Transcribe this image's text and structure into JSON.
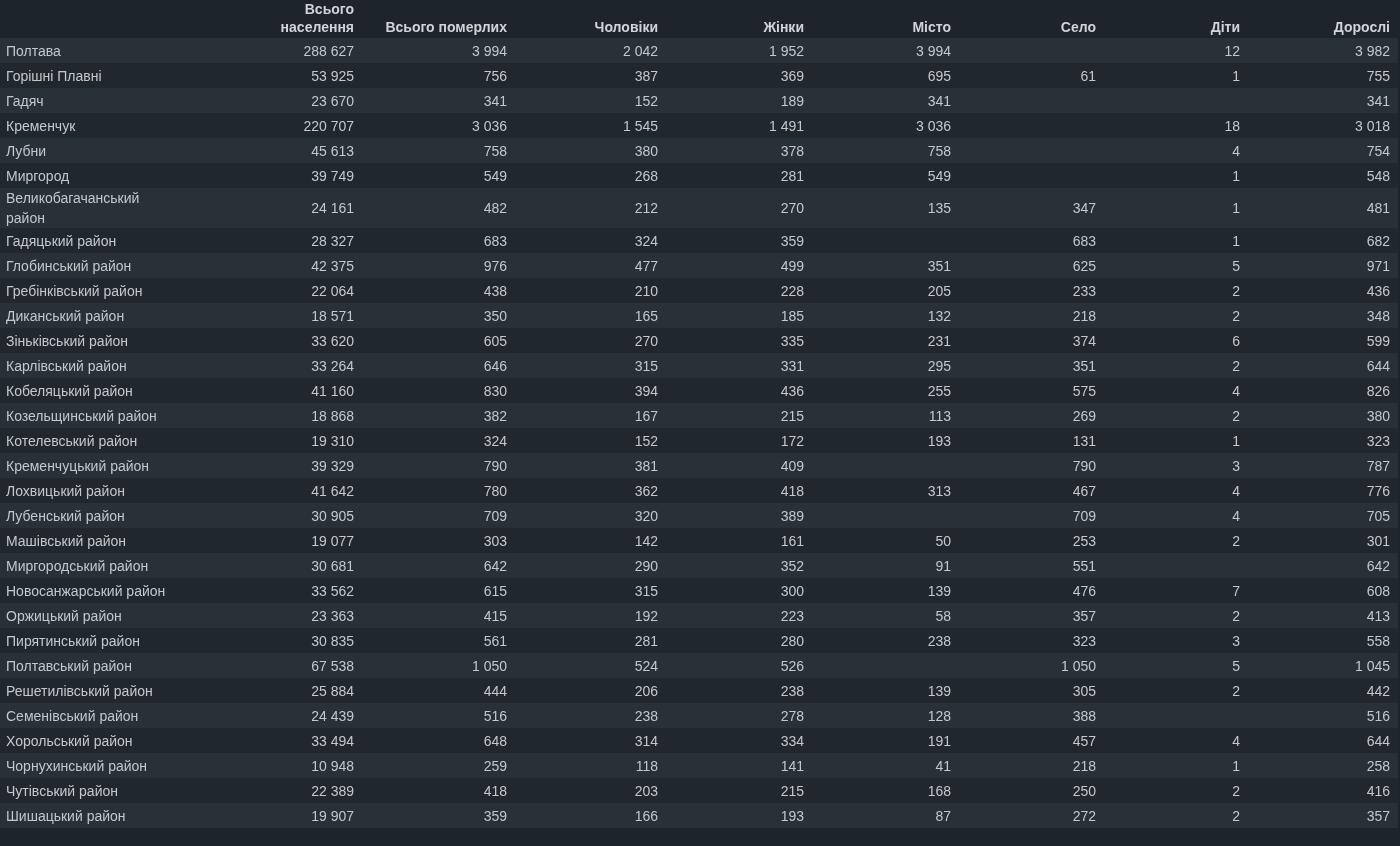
{
  "table": {
    "columns": [
      "Всього населення",
      "Всього померлих",
      "Чоловіки",
      "Жінки",
      "Місто",
      "Село",
      "Діти",
      "Дорослі"
    ],
    "rows": [
      {
        "name": "Полтава",
        "population": "288 627",
        "deaths": "3 994",
        "men": "2 042",
        "women": "1 952",
        "city": "3 994",
        "children": "12",
        "adults": "3 982"
      },
      {
        "name": "Горішні Плавні",
        "population": "53 925",
        "deaths": "756",
        "men": "387",
        "women": "369",
        "city": "695",
        "village": "61",
        "children": "1",
        "adults": "755"
      },
      {
        "name": "Гадяч",
        "population": "23 670",
        "deaths": "341",
        "men": "152",
        "women": "189",
        "city": "341",
        "adults": "341"
      },
      {
        "name": "Кременчук",
        "population": "220 707",
        "deaths": "3 036",
        "men": "1 545",
        "women": "1 491",
        "city": "3 036",
        "children": "18",
        "adults": "3 018"
      },
      {
        "name": "Лубни",
        "population": "45 613",
        "deaths": "758",
        "men": "380",
        "women": "378",
        "city": "758",
        "children": "4",
        "adults": "754"
      },
      {
        "name": "Миргород",
        "population": "39 749",
        "deaths": "549",
        "men": "268",
        "women": "281",
        "city": "549",
        "children": "1",
        "adults": "548"
      },
      {
        "name": "Великобагачанський район",
        "population": "24 161",
        "deaths": "482",
        "men": "212",
        "women": "270",
        "city": "135",
        "village": "347",
        "children": "1",
        "adults": "481"
      },
      {
        "name": "Гадяцький район",
        "population": "28 327",
        "deaths": "683",
        "men": "324",
        "women": "359",
        "village": "683",
        "children": "1",
        "adults": "682"
      },
      {
        "name": "Глобинський район",
        "population": "42 375",
        "deaths": "976",
        "men": "477",
        "women": "499",
        "city": "351",
        "village": "625",
        "children": "5",
        "adults": "971"
      },
      {
        "name": "Гребінківський район",
        "population": "22 064",
        "deaths": "438",
        "men": "210",
        "women": "228",
        "city": "205",
        "village": "233",
        "children": "2",
        "adults": "436"
      },
      {
        "name": "Диканський район",
        "population": "18 571",
        "deaths": "350",
        "men": "165",
        "women": "185",
        "city": "132",
        "village": "218",
        "children": "2",
        "adults": "348"
      },
      {
        "name": "Зіньківський район",
        "population": "33 620",
        "deaths": "605",
        "men": "270",
        "women": "335",
        "city": "231",
        "village": "374",
        "children": "6",
        "adults": "599"
      },
      {
        "name": "Карлівський район",
        "population": "33 264",
        "deaths": "646",
        "men": "315",
        "women": "331",
        "city": "295",
        "village": "351",
        "children": "2",
        "adults": "644"
      },
      {
        "name": "Кобеляцький район",
        "population": "41 160",
        "deaths": "830",
        "men": "394",
        "women": "436",
        "city": "255",
        "village": "575",
        "children": "4",
        "adults": "826"
      },
      {
        "name": "Козельщинський район",
        "population": "18 868",
        "deaths": "382",
        "men": "167",
        "women": "215",
        "city": "113",
        "village": "269",
        "children": "2",
        "adults": "380"
      },
      {
        "name": "Котелевський район",
        "population": "19 310",
        "deaths": "324",
        "men": "152",
        "women": "172",
        "city": "193",
        "village": "131",
        "children": "1",
        "adults": "323"
      },
      {
        "name": "Кременчуцький район",
        "population": "39 329",
        "deaths": "790",
        "men": "381",
        "women": "409",
        "village": "790",
        "children": "3",
        "adults": "787"
      },
      {
        "name": "Лохвицький район",
        "population": "41 642",
        "deaths": "780",
        "men": "362",
        "women": "418",
        "city": "313",
        "village": "467",
        "children": "4",
        "adults": "776"
      },
      {
        "name": "Лубенський район",
        "population": "30 905",
        "deaths": "709",
        "men": "320",
        "women": "389",
        "village": "709",
        "children": "4",
        "adults": "705"
      },
      {
        "name": "Машівський район",
        "population": "19 077",
        "deaths": "303",
        "men": "142",
        "women": "161",
        "city": "50",
        "village": "253",
        "children": "2",
        "adults": "301"
      },
      {
        "name": "Миргородський район",
        "population": "30 681",
        "deaths": "642",
        "men": "290",
        "women": "352",
        "city": "91",
        "village": "551",
        "adults": "642"
      },
      {
        "name": "Новосанжарський район",
        "population": "33 562",
        "deaths": "615",
        "men": "315",
        "women": "300",
        "city": "139",
        "village": "476",
        "children": "7",
        "adults": "608"
      },
      {
        "name": "Оржицький район",
        "population": "23 363",
        "deaths": "415",
        "men": "192",
        "women": "223",
        "city": "58",
        "village": "357",
        "children": "2",
        "adults": "413"
      },
      {
        "name": "Пирятинський район",
        "population": "30 835",
        "deaths": "561",
        "men": "281",
        "women": "280",
        "city": "238",
        "village": "323",
        "children": "3",
        "adults": "558"
      },
      {
        "name": "Полтавський район",
        "population": "67 538",
        "deaths": "1 050",
        "men": "524",
        "women": "526",
        "village": "1 050",
        "children": "5",
        "adults": "1 045"
      },
      {
        "name": "Решетилівський район",
        "population": "25 884",
        "deaths": "444",
        "men": "206",
        "women": "238",
        "city": "139",
        "village": "305",
        "children": "2",
        "adults": "442"
      },
      {
        "name": "Семенівський район",
        "population": "24 439",
        "deaths": "516",
        "men": "238",
        "women": "278",
        "city": "128",
        "village": "388",
        "adults": "516"
      },
      {
        "name": "Хорольський район",
        "population": "33 494",
        "deaths": "648",
        "men": "314",
        "women": "334",
        "city": "191",
        "village": "457",
        "children": "4",
        "adults": "644"
      },
      {
        "name": "Чорнухинський район",
        "population": "10 948",
        "deaths": "259",
        "men": "118",
        "women": "141",
        "city": "41",
        "village": "218",
        "children": "1",
        "adults": "258"
      },
      {
        "name": "Чутівський район",
        "population": "22 389",
        "deaths": "418",
        "men": "203",
        "women": "215",
        "city": "168",
        "village": "250",
        "children": "2",
        "adults": "416"
      },
      {
        "name": "Шишацький район",
        "population": "19 907",
        "deaths": "359",
        "men": "166",
        "women": "193",
        "city": "87",
        "village": "272",
        "children": "2",
        "adults": "357"
      }
    ]
  }
}
